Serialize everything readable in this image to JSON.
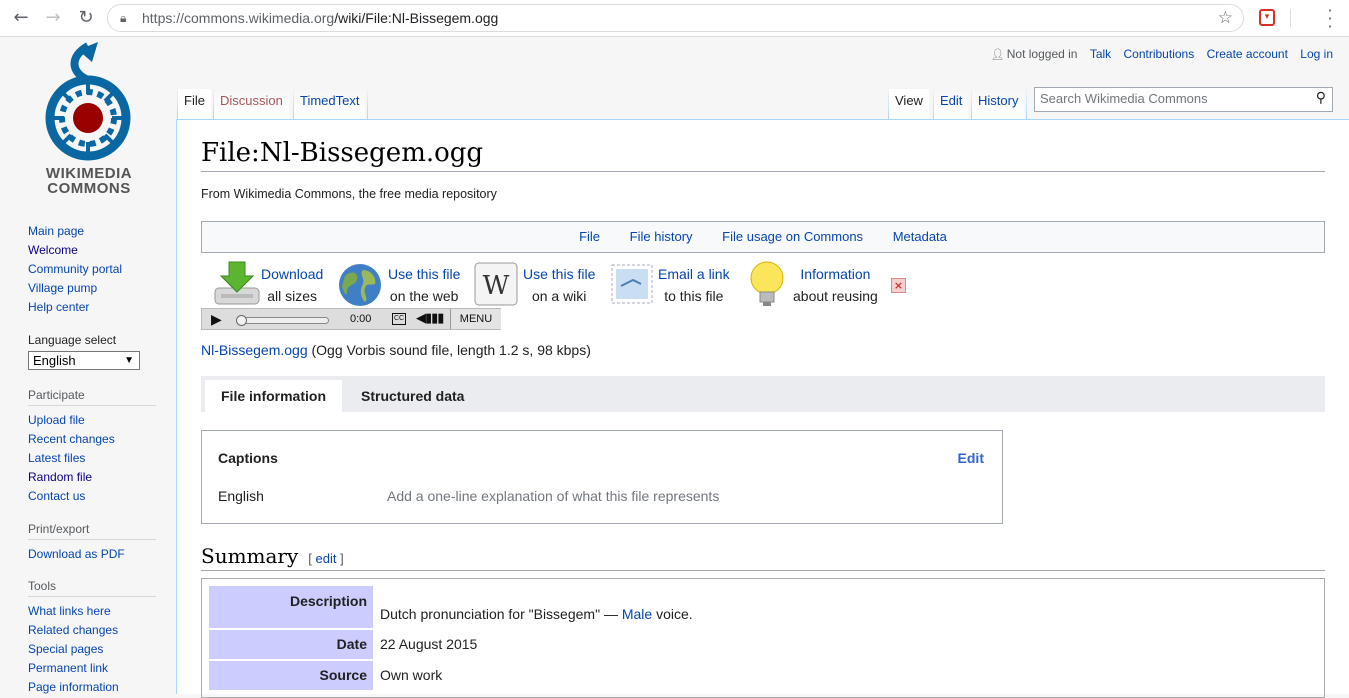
{
  "browser": {
    "url_host": "https://commons.wikimedia.org",
    "url_path": "/wiki/File:Nl-Bissegem.ogg"
  },
  "logo": {
    "line1": "WIKIMEDIA",
    "line2": "COMMONS"
  },
  "personal": {
    "not_logged_in": "Not logged in",
    "talk": "Talk",
    "contributions": "Contributions",
    "create_account": "Create account",
    "log_in": "Log in"
  },
  "tabs": {
    "file": "File",
    "discussion": "Discussion",
    "timedtext": "TimedText",
    "view": "View",
    "edit": "Edit",
    "history": "History"
  },
  "search": {
    "placeholder": "Search Wikimedia Commons"
  },
  "sidebar": {
    "nav": [
      "Main page",
      "Welcome",
      "Community portal",
      "Village pump",
      "Help center"
    ],
    "language_head": "Language select",
    "language_value": "English",
    "participate_head": "Participate",
    "participate": [
      "Upload file",
      "Recent changes",
      "Latest files",
      "Random file",
      "Contact us"
    ],
    "print_head": "Print/export",
    "print": [
      "Download as PDF"
    ],
    "tools_head": "Tools",
    "tools": [
      "What links here",
      "Related changes",
      "Special pages",
      "Permanent link",
      "Page information"
    ]
  },
  "page": {
    "title": "File:Nl-Bissegem.ogg",
    "site_sub": "From Wikimedia Commons, the free media repository",
    "filetoc": [
      "File",
      "File history",
      "File usage on Commons",
      "Metadata"
    ],
    "tools": {
      "download_1": "Download",
      "download_2": "all sizes",
      "web_1": "Use this file",
      "web_2": "on the web",
      "wiki_1": "Use this file",
      "wiki_2": "on a wiki",
      "email_1": "Email a link",
      "email_2": "to this file",
      "info_1": "Information",
      "info_2": "about reusing"
    },
    "player": {
      "time": "0:00",
      "cc": "CC",
      "menu": "MENU"
    },
    "file_link": "Nl-Bissegem.ogg",
    "file_desc": " (Ogg Vorbis sound file, length 1.2 s, 98 kbps)",
    "info_tabs": [
      "File information",
      "Structured data"
    ],
    "captions": {
      "heading": "Captions",
      "edit": "Edit",
      "lang": "English",
      "placeholder": "Add a one-line explanation of what this file represents"
    },
    "summary": {
      "heading": "Summary",
      "edit_open": "[ ",
      "edit": "edit",
      "edit_close": " ]"
    },
    "info": {
      "description_key": "Description",
      "description_pre": "Dutch pronunciation for \"Bissegem\" — ",
      "description_link": "Male",
      "description_post": " voice.",
      "date_key": "Date",
      "date_val": "22 August 2015",
      "source_key": "Source",
      "source_val": "Own work"
    }
  },
  "colors": {
    "link": "#0645ad",
    "accent": "#36c",
    "border": "#a7d7f9",
    "logo_blue": "#0b67a2",
    "logo_red": "#990000",
    "label_bg": "#ccccff"
  }
}
